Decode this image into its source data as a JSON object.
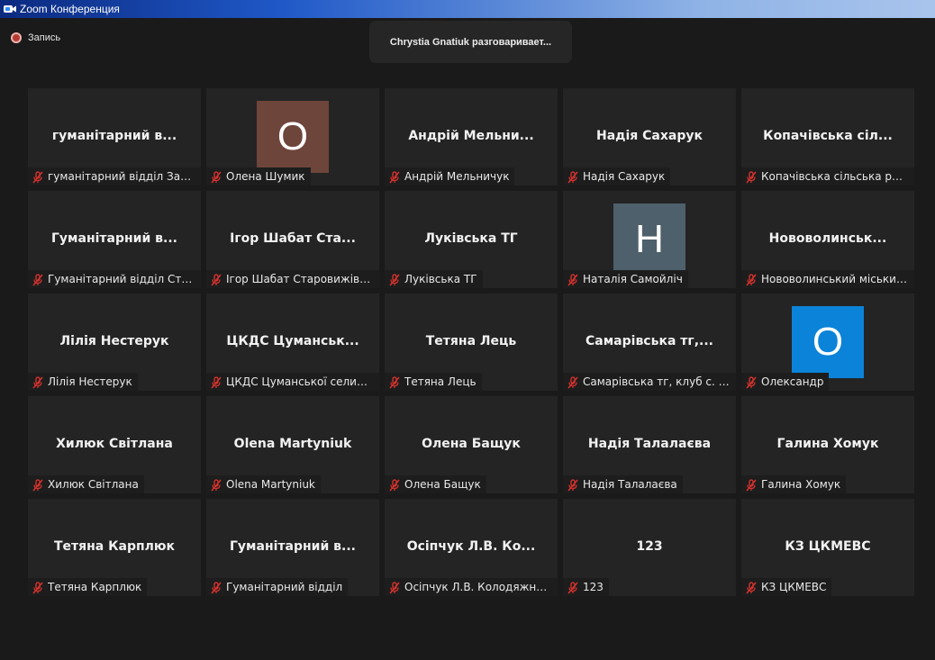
{
  "window": {
    "title": "Zoom Конференция"
  },
  "recording": {
    "label": "Запись"
  },
  "speaker": {
    "text": "Chrystia Gnatiuk разговаривает..."
  },
  "colors": {
    "muted_mic": "#d2322d",
    "avatar_brown": "#6e453b",
    "avatar_slate": "#4d606b",
    "avatar_blue": "#0b83d8"
  },
  "participants": [
    {
      "display": "гуманітарний в...",
      "name": "гуманітарний відділ Затур..."
    },
    {
      "avatar": "О",
      "avatar_color": "#6e453b",
      "name": "Олена Шумик"
    },
    {
      "display": "Андрій  Мельни...",
      "name": "Андрій Мельничук"
    },
    {
      "display": "Надія Сахарук",
      "name": "Надія Сахарук"
    },
    {
      "display": "Копачівська  сіл...",
      "name": "Копачівська сільська рада"
    },
    {
      "display": "Гуманітарний  в...",
      "name": "Гуманітарний відділ Старо..."
    },
    {
      "display": "Ігор  Шабат  Ста...",
      "name": "Ігор Шабат Старовижівсь..."
    },
    {
      "display": "Луківська ТГ",
      "name": "Луківська ТГ"
    },
    {
      "avatar": "Н",
      "avatar_color": "#4d606b",
      "name": "Наталія Самойліч"
    },
    {
      "display": "Нововолинськ...",
      "name": "Нововолинський міський ..."
    },
    {
      "display": "Лілія Нестерук",
      "name": "Лілія Нестерук"
    },
    {
      "display": "ЦКДС  Цуманськ...",
      "name": "ЦКДС Цуманської селищн..."
    },
    {
      "display": "Тетяна Лець",
      "name": "Тетяна Лець"
    },
    {
      "display": "Самарівська  тг,...",
      "name": "Самарівська тг, клуб с. Яз..."
    },
    {
      "avatar": "О",
      "avatar_color": "#0b83d8",
      "name": "Олександр"
    },
    {
      "display": "Хилюк Світлана",
      "name": "Хилюк Світлана"
    },
    {
      "display": "Olena Martyniuk",
      "name": "Olena Martyniuk"
    },
    {
      "display": "Олена Бащук",
      "name": "Олена Бащук"
    },
    {
      "display": "Надія Талалаєва",
      "name": "Надія Талалаєва"
    },
    {
      "display": "Галина Хомук",
      "name": "Галина Хомук"
    },
    {
      "display": "Тетяна Карплюк",
      "name": "Тетяна Карплюк"
    },
    {
      "display": "Гуманітарний  в...",
      "name": "Гуманітарний відділ"
    },
    {
      "display": "Осіпчук  Л.В.  Ко...",
      "name": "Осіпчук Л.В. Колодяжне ТГ"
    },
    {
      "display": "123",
      "name": "123"
    },
    {
      "display": "КЗ ЦКМЕВС",
      "name": "КЗ ЦКМЕВС"
    }
  ]
}
